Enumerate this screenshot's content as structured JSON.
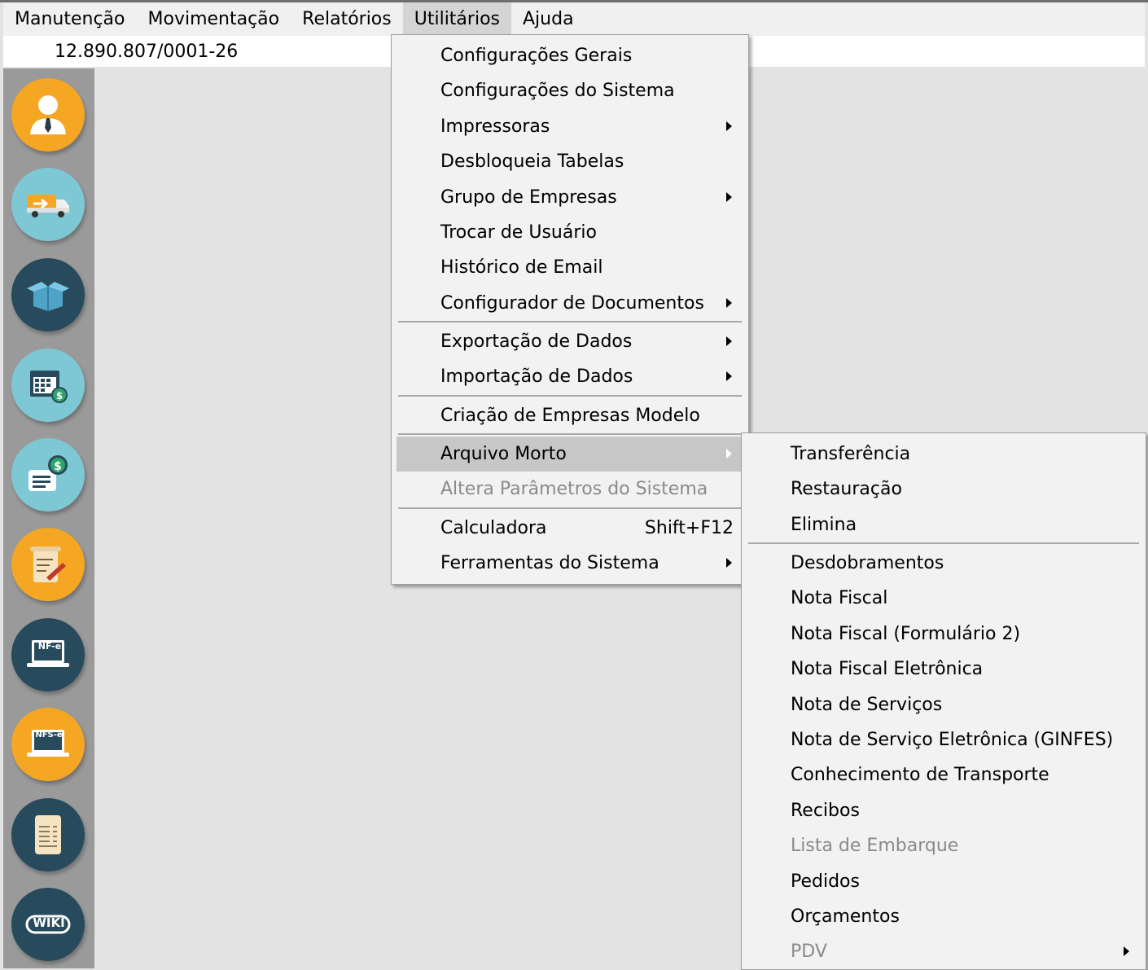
{
  "menubar": {
    "items": [
      "Manutenção",
      "Movimentação",
      "Relatórios",
      "Utilitários",
      "Ajuda"
    ]
  },
  "infobar": {
    "cnpj": "12.890.807/0001-26"
  },
  "sidebar": {
    "buttons": [
      {
        "name": "user-icon",
        "color": "#f5a623"
      },
      {
        "name": "delivery-truck-icon",
        "color": "#7ec8d6"
      },
      {
        "name": "open-box-icon",
        "color": "#274b5c"
      },
      {
        "name": "calendar-money-icon",
        "color": "#7ec8d6"
      },
      {
        "name": "money-document-icon",
        "color": "#7ec8d6"
      },
      {
        "name": "contract-signature-icon",
        "color": "#f5a623"
      },
      {
        "name": "nfe-laptop-icon",
        "color": "#274b5c"
      },
      {
        "name": "nfse-laptop-icon",
        "color": "#f5a623"
      },
      {
        "name": "receipt-icon",
        "color": "#274b5c"
      },
      {
        "name": "wiki-icon",
        "color": "#274b5c"
      }
    ],
    "labels": {
      "nfe": "NF-e",
      "nfse": "NFS-e",
      "wiki": "WIKI"
    }
  },
  "util_menu": {
    "items": [
      {
        "label": "Configurações Gerais"
      },
      {
        "label": "Configurações do Sistema"
      },
      {
        "label": "Impressoras"
      },
      {
        "label": "Desbloqueia Tabelas"
      },
      {
        "label": "Grupo de Empresas"
      },
      {
        "label": "Trocar de Usuário"
      },
      {
        "label": "Histórico de Email"
      },
      {
        "label": "Configurador de Documentos"
      },
      {
        "label": "Exportação de Dados"
      },
      {
        "label": "Importação de Dados"
      },
      {
        "label": "Criação de Empresas Modelo"
      },
      {
        "label": "Arquivo Morto"
      },
      {
        "label": "Altera Parâmetros do Sistema"
      },
      {
        "label": "Calculadora",
        "shortcut": "Shift+F12"
      },
      {
        "label": "Ferramentas do Sistema"
      }
    ]
  },
  "arq_menu": {
    "items": [
      {
        "label": "Transferência"
      },
      {
        "label": "Restauração"
      },
      {
        "label": "Elimina"
      },
      {
        "label": "Desdobramentos"
      },
      {
        "label": "Nota Fiscal"
      },
      {
        "label": "Nota Fiscal (Formulário 2)"
      },
      {
        "label": "Nota Fiscal Eletrônica"
      },
      {
        "label": "Nota de Serviços"
      },
      {
        "label": "Nota de Serviço Eletrônica (GINFES)"
      },
      {
        "label": "Conhecimento de Transporte"
      },
      {
        "label": "Recibos"
      },
      {
        "label": "Lista de Embarque"
      },
      {
        "label": "Pedidos"
      },
      {
        "label": "Orçamentos"
      },
      {
        "label": "PDV"
      }
    ]
  },
  "colors": {
    "menu_bg": "#f2f2f2",
    "highlight": "#c7c7c7",
    "disabled_text": "#8a8a8a",
    "sidebar_bg": "#9a9a9a"
  }
}
